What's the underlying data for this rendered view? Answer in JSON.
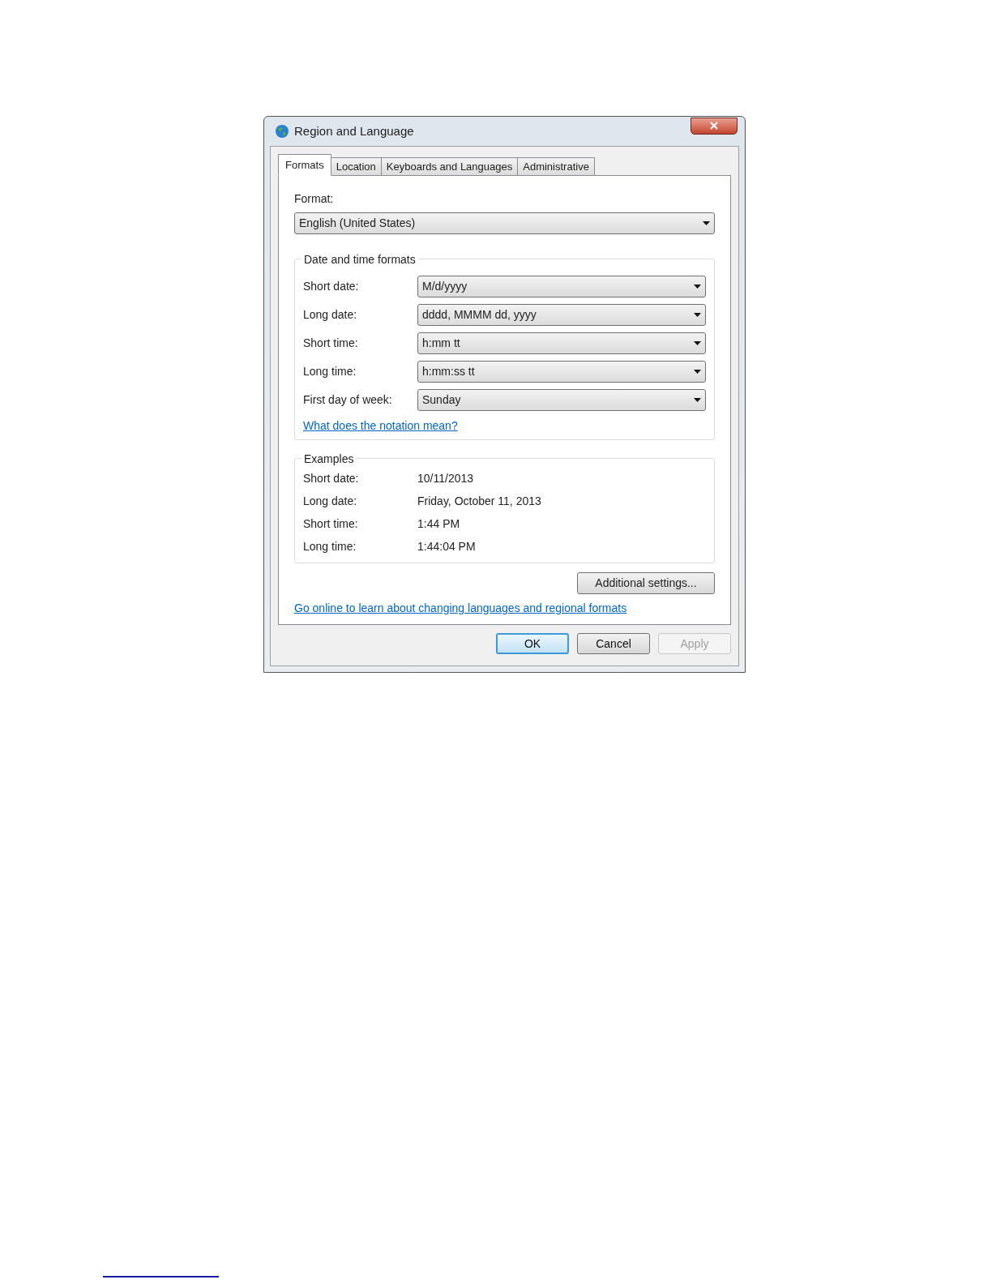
{
  "window": {
    "title": "Region and Language"
  },
  "tabs": [
    {
      "label": "Formats",
      "selected": true
    },
    {
      "label": "Location",
      "selected": false
    },
    {
      "label": "Keyboards and Languages",
      "selected": false
    },
    {
      "label": "Administrative",
      "selected": false
    }
  ],
  "format": {
    "label": "Format:",
    "value": "English (United States)"
  },
  "date_time_formats": {
    "title": "Date and time formats",
    "rows": [
      {
        "label": "Short date:",
        "value": "M/d/yyyy"
      },
      {
        "label": "Long date:",
        "value": "dddd, MMMM dd, yyyy"
      },
      {
        "label": "Short time:",
        "value": "h:mm tt"
      },
      {
        "label": "Long time:",
        "value": "h:mm:ss tt"
      },
      {
        "label": "First day of week:",
        "value": "Sunday"
      }
    ],
    "link": "What does the notation mean?"
  },
  "examples": {
    "title": "Examples",
    "rows": [
      {
        "label": "Short date:",
        "value": "10/11/2013"
      },
      {
        "label": "Long date:",
        "value": "Friday, October 11, 2013"
      },
      {
        "label": "Short time:",
        "value": "1:44 PM"
      },
      {
        "label": "Long time:",
        "value": "1:44:04 PM"
      }
    ]
  },
  "additional_button": "Additional settings...",
  "online_link": "Go online to learn about changing languages and regional formats",
  "buttons": [
    {
      "label": "OK",
      "default": true,
      "disabled": false
    },
    {
      "label": "Cancel",
      "default": false,
      "disabled": false
    },
    {
      "label": "Apply",
      "default": false,
      "disabled": true
    }
  ]
}
